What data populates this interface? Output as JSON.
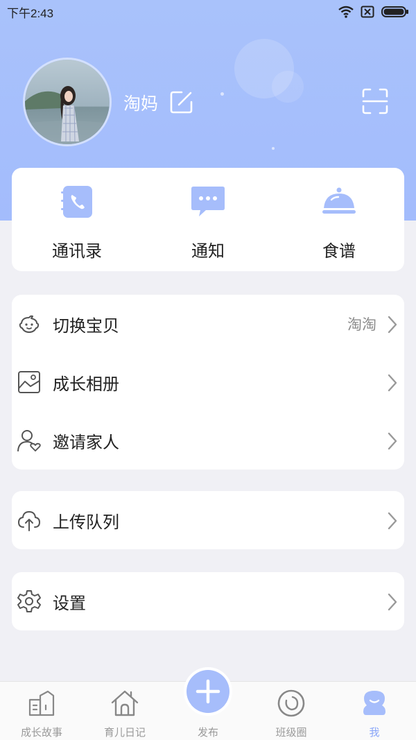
{
  "status_bar": {
    "time": "下午2:43",
    "icons": [
      "wifi-icon",
      "no-sim-icon",
      "battery-icon"
    ]
  },
  "profile": {
    "name": "淘妈",
    "avatar": "avatar-photo",
    "edit_icon": "edit-icon",
    "scan_icon": "scan-icon"
  },
  "quick_actions": [
    {
      "label": "通讯录",
      "icon": "contacts-icon"
    },
    {
      "label": "通知",
      "icon": "notification-chat-icon"
    },
    {
      "label": "食谱",
      "icon": "recipe-cloche-icon"
    }
  ],
  "menu_groups": [
    [
      {
        "label": "切换宝贝",
        "value": "淘淘",
        "icon": "baby-face-icon"
      },
      {
        "label": "成长相册",
        "value": "",
        "icon": "photo-album-icon"
      },
      {
        "label": "邀请家人",
        "value": "",
        "icon": "invite-family-icon"
      }
    ],
    [
      {
        "label": "上传队列",
        "value": "",
        "icon": "upload-cloud-icon"
      }
    ],
    [
      {
        "label": "设置",
        "value": "",
        "icon": "settings-gear-icon"
      }
    ]
  ],
  "tab_bar": {
    "tabs": [
      {
        "label": "成长故事",
        "icon": "growth-story-icon",
        "active": false
      },
      {
        "label": "育儿日记",
        "icon": "home-icon",
        "active": false
      },
      {
        "label": "发布",
        "icon": "plus-icon",
        "active": false
      },
      {
        "label": "班级圈",
        "icon": "class-circle-icon",
        "active": false
      },
      {
        "label": "我",
        "icon": "me-icon",
        "active": true
      }
    ]
  },
  "colors": {
    "accent": "#a6bdfb",
    "accent_dark": "#8aa6f8",
    "hero": "#a9c2fb",
    "background": "#f0f0f5"
  }
}
